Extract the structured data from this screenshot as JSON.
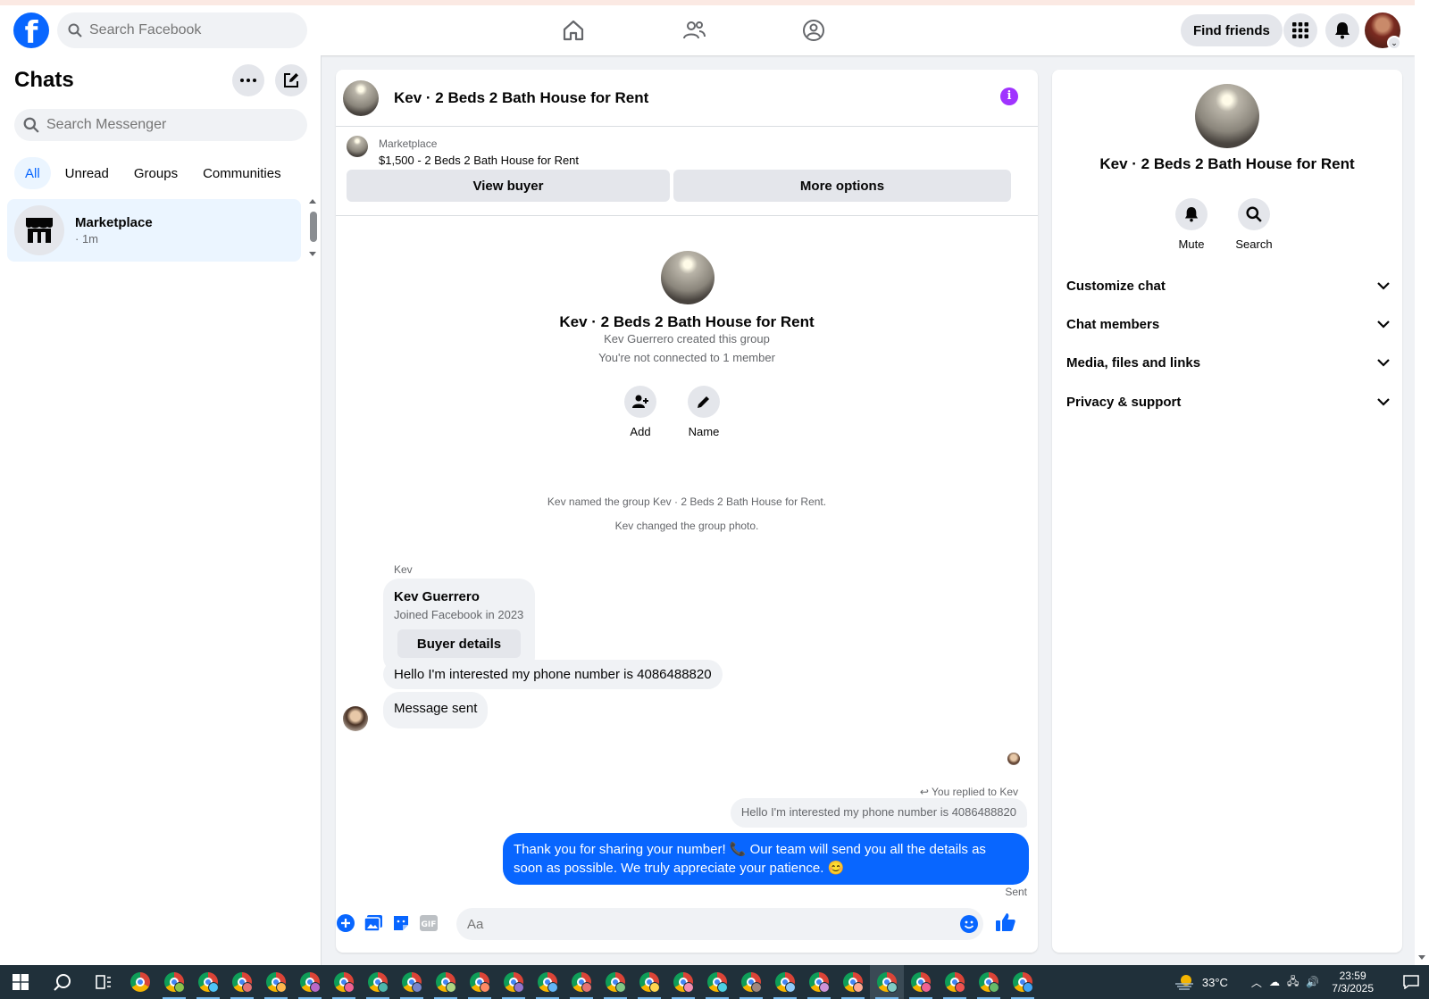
{
  "topnav": {
    "search_placeholder": "Search Facebook",
    "find_friends": "Find friends",
    "brand_color": "#0866ff"
  },
  "sidebar": {
    "title": "Chats",
    "search_placeholder": "Search Messenger",
    "filters": [
      "All",
      "Unread",
      "Groups",
      "Communities"
    ],
    "active_filter": "All",
    "chats": [
      {
        "name": "Marketplace",
        "time": "· 1m",
        "icon": "storefront-icon"
      }
    ]
  },
  "conversation": {
    "title": "Kev · 2 Beds 2 Bath House for Rent",
    "listing": {
      "source": "Marketplace",
      "price_title": "$1,500 - 2 Beds 2 Bath House for Rent",
      "view_buyer": "View buyer",
      "more_options": "More options"
    },
    "intro": {
      "title": "Kev · 2 Beds 2 Bath House for Rent",
      "created_by": "Kev Guerrero created this group",
      "connection": "You're not connected to 1 member",
      "actions": [
        {
          "label": "Add",
          "icon": "add-person-icon"
        },
        {
          "label": "Name",
          "icon": "pencil-icon"
        }
      ]
    },
    "system_messages": [
      "Kev named the group Kev · 2 Beds 2 Bath House for Rent.",
      "Kev changed the group photo."
    ],
    "sender_label": "Kev",
    "profile_card": {
      "name": "Kev Guerrero",
      "subtitle": "Joined Facebook in 2023",
      "button": "Buyer details"
    },
    "incoming": [
      "Hello I'm interested my phone number is 4086488820",
      "Message sent"
    ],
    "reply": {
      "label": "You replied to Kev",
      "quoted": "Hello I'm interested my phone number is 4086488820",
      "text": "Thank you for sharing your number! 📞 Our team will send you all the details as soon as possible. We truly appreciate your patience. 😊",
      "status": "Sent"
    },
    "composer": {
      "placeholder": "Aa"
    }
  },
  "info_panel": {
    "title": "Kev · 2 Beds 2 Bath House for Rent",
    "actions": [
      {
        "label": "Mute",
        "icon": "bell-icon"
      },
      {
        "label": "Search",
        "icon": "search-icon"
      }
    ],
    "sections": [
      "Customize chat",
      "Chat members",
      "Media, files and links",
      "Privacy & support"
    ]
  },
  "taskbar": {
    "weather": "33°C",
    "time": "23:59",
    "date": "7/3/2025",
    "profile_colors": [
      "#8bc34a",
      "#4fc3f7",
      "#e57373",
      "#ffb74d",
      "#ba68c8",
      "#f06292",
      "#4db6ac",
      "#7986cb",
      "#aed581",
      "#ff8a65",
      "#9575cd",
      "#64b5f6",
      "#e57373",
      "#81c784",
      "#ffd54f",
      "#f48fb1",
      "#4dd0e1",
      "#a1887f",
      "#90caf9",
      "#ce93d8",
      "#ffab91",
      "#80cbc4",
      "#f06292",
      "#ef5350",
      "#66bb6a",
      "#42a5f5"
    ]
  }
}
